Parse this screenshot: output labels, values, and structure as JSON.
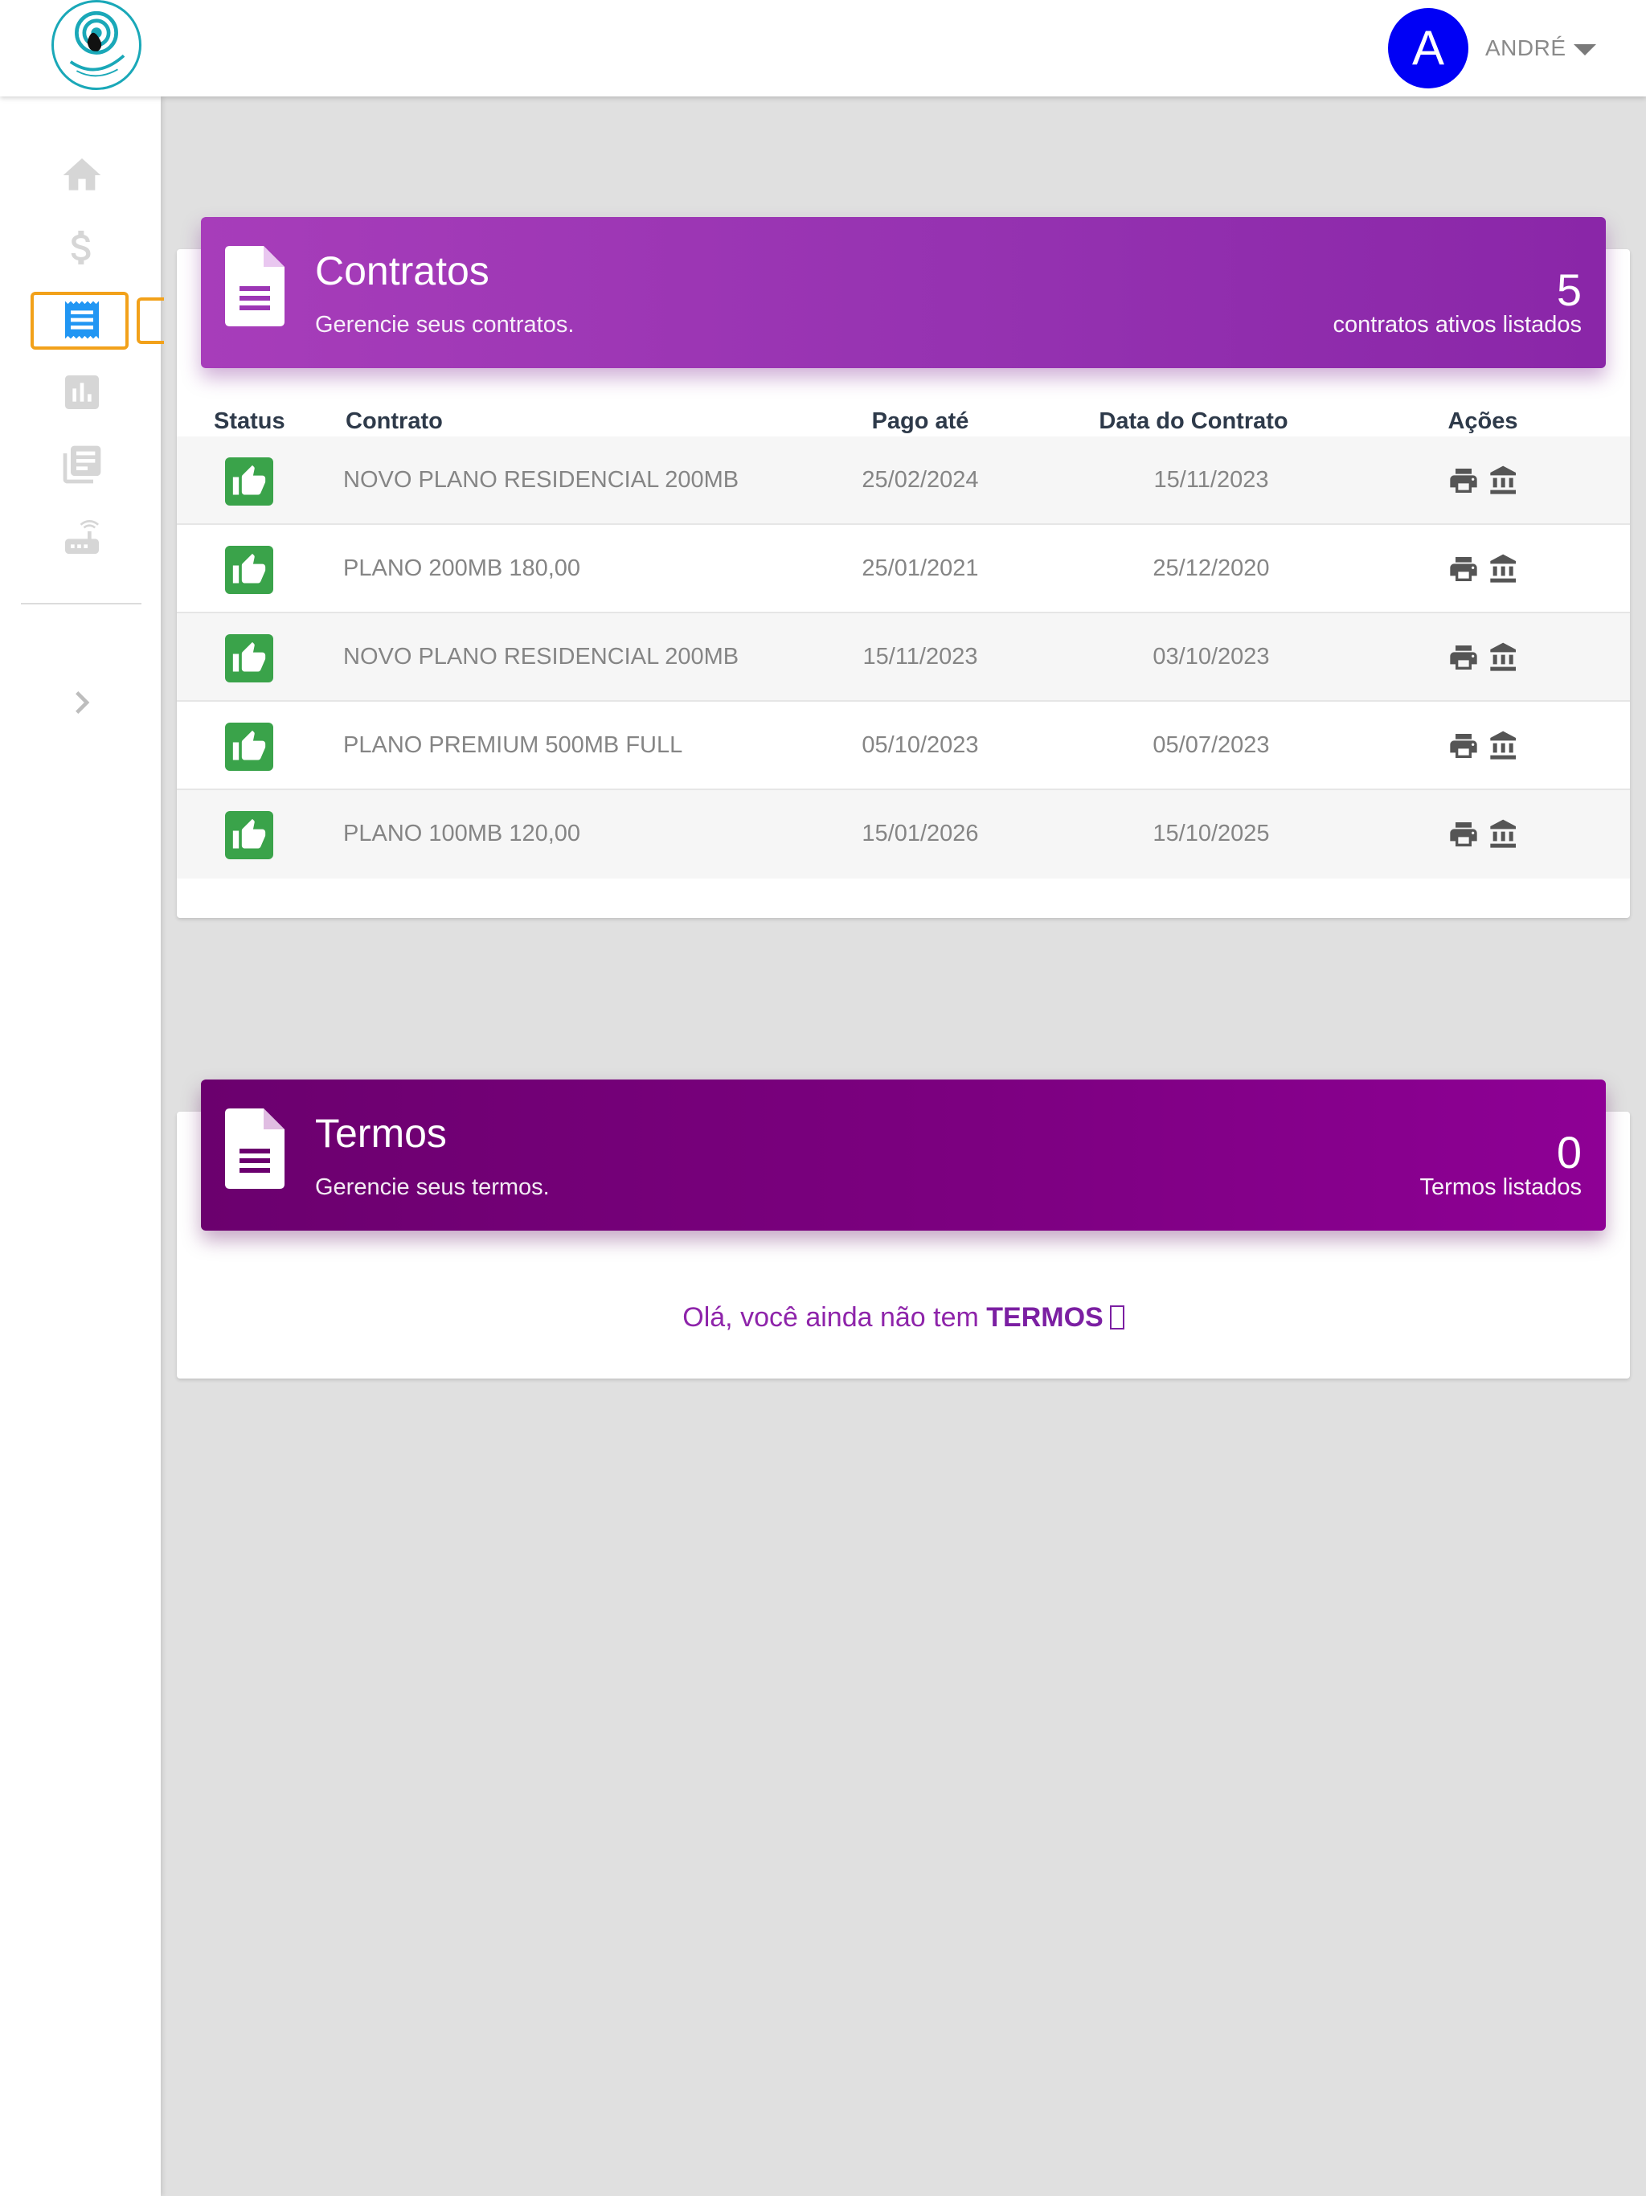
{
  "header": {
    "logo_alt": "Facilita Net",
    "user": {
      "initial": "A",
      "name": "ANDRÉ"
    }
  },
  "sidebar": {
    "items": [
      {
        "icon": "home-icon"
      },
      {
        "icon": "dollar-icon"
      },
      {
        "icon": "receipt-icon",
        "active": true
      },
      {
        "icon": "bar-chart-icon"
      },
      {
        "icon": "library-books-icon"
      },
      {
        "icon": "router-icon"
      }
    ],
    "expand_icon": "chevron-right-icon"
  },
  "contratos": {
    "title": "Contratos",
    "subtitle": "Gerencie seus contratos.",
    "count": "5",
    "count_label": "contratos ativos listados",
    "columns": [
      "Status",
      "Contrato",
      "Pago até",
      "Data do Contrato",
      "Ações"
    ],
    "rows": [
      {
        "contrato": "NOVO PLANO RESIDENCIAL 200MB",
        "pago_ate": "25/02/2024",
        "data_contrato": "15/11/2023"
      },
      {
        "contrato": "PLANO 200MB 180,00",
        "pago_ate": "25/01/2021",
        "data_contrato": "25/12/2020"
      },
      {
        "contrato": "NOVO PLANO RESIDENCIAL 200MB",
        "pago_ate": "15/11/2023",
        "data_contrato": "03/10/2023"
      },
      {
        "contrato": "PLANO PREMIUM 500MB FULL",
        "pago_ate": "05/10/2023",
        "data_contrato": "05/07/2023"
      },
      {
        "contrato": "PLANO 100MB 120,00",
        "pago_ate": "15/01/2026",
        "data_contrato": "15/10/2025"
      }
    ]
  },
  "termos": {
    "title": "Termos",
    "subtitle": "Gerencie seus termos.",
    "count": "0",
    "count_label": "Termos listados",
    "empty_prefix": "Olá, você ainda não tem",
    "empty_strong": "TERMOS"
  },
  "colors": {
    "accent_contratos": "#9c36b5",
    "accent_termos": "#7b007f",
    "status_ok": "#3aa34a",
    "avatar": "#0000f5",
    "active_nav": "#2196f3",
    "highlight_frame": "#f2a11a"
  }
}
